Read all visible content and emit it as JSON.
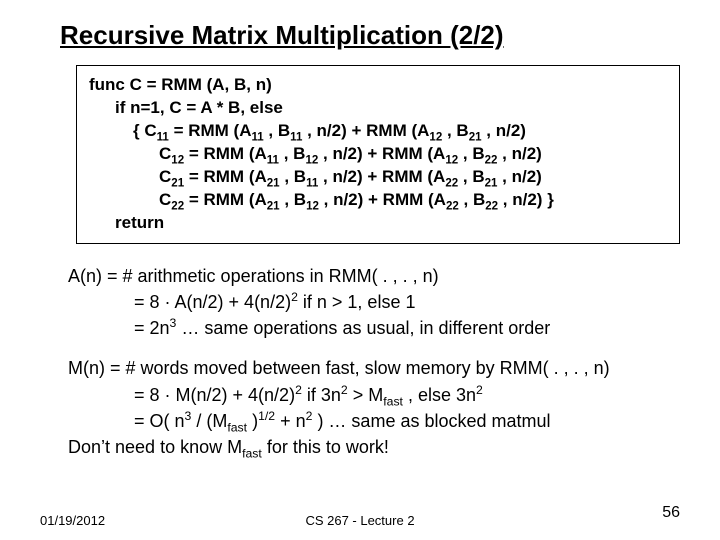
{
  "title": "Recursive Matrix Multiplication (2/2)",
  "code": {
    "l1": "func C = RMM (A, B, n)",
    "l2": "if n=1, C = A * B, else",
    "l3_pre": "{  C",
    "l3_mid1": " = RMM (A",
    "l3_mid2": " , B",
    "l3_mid3": " , n/2) + RMM (A",
    "l3_mid4": " , B",
    "l3_end": " , n/2)",
    "l4_pre": "C",
    "brace_close": "  }",
    "ret": "return",
    "sub": {
      "11": "11",
      "12": "12",
      "21": "21",
      "22": "22"
    }
  },
  "analysis": {
    "a1": "A(n)  = # arithmetic operations in RMM( . , . , n)",
    "a2_pre": "= 8 · A(n/2) + 4(n/2)",
    "a2_post": "  if  n > 1,   else 1",
    "a3_pre": "= 2n",
    "a3_post": "   … same operations as usual, in different order",
    "m1": "M(n) = # words moved between fast, slow memory by RMM( . , . , n)",
    "m2_pre": "= 8 · M(n/2) + 4(n/2)",
    "m2_mid": "  if  3n",
    "m2_mid2": " > M",
    "m2_mid3": " ,  else 3n",
    "m3_pre": "= O( n",
    "m3_mid1": " / (M",
    "m3_mid2": " )",
    "m3_mid3": " + n",
    "m3_post": " )   … same as blocked matmul",
    "m4_pre": "Don’t need to know M",
    "m4_post": " for this to work!",
    "fast": "fast",
    "sup2": "2",
    "sup3": "3",
    "sup12": "1/2"
  },
  "footer": {
    "date": "01/19/2012",
    "center": "CS 267 - Lecture 2",
    "page": "56"
  }
}
